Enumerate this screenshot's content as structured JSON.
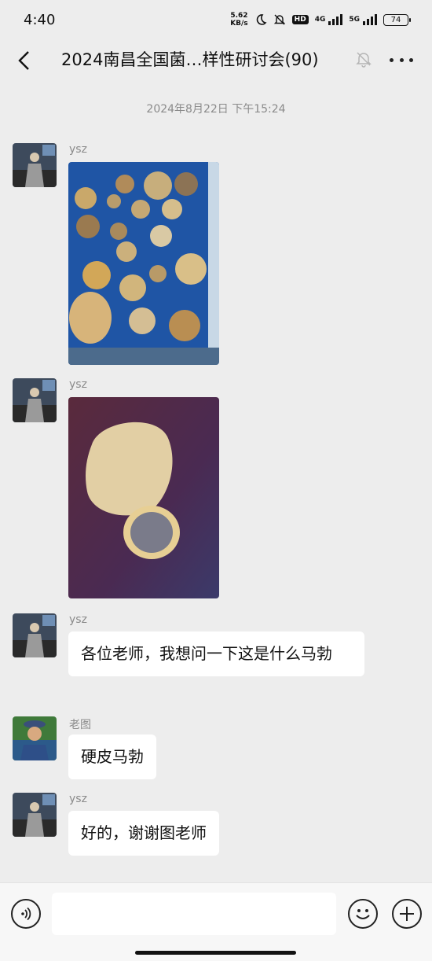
{
  "status_bar": {
    "time": "4:40",
    "speed_value": "5.62",
    "speed_unit": "KB/s",
    "hd_badge": "HD",
    "network_1": "4G",
    "network_2": "5G",
    "battery": "74"
  },
  "header": {
    "title": "2024南昌全国菌…样性研讨会(90)",
    "back_icon": "chevron-left-icon",
    "mute_icon": "bell-off-icon",
    "more_icon": "more-dots-icon"
  },
  "chat": {
    "timestamp": "2024年8月22日 下午15:24",
    "messages": [
      {
        "sender": "ysz",
        "type": "image",
        "image_desc": "puffballs on blue cloth"
      },
      {
        "sender": "ysz",
        "type": "image",
        "image_desc": "puffball and cross-section on purple surface"
      },
      {
        "sender": "ysz",
        "type": "text",
        "text": "各位老师，我想问一下这是什么马勃"
      },
      {
        "sender": "老图",
        "type": "text",
        "text": "硬皮马勃"
      },
      {
        "sender": "ysz",
        "type": "text",
        "text": "好的，谢谢图老师"
      }
    ]
  },
  "input_bar": {
    "voice_icon": "voice-icon",
    "emoji_icon": "emoji-icon",
    "plus_icon": "plus-icon",
    "input_value": ""
  },
  "colors": {
    "background": "#ededed",
    "bubble": "#ffffff",
    "meta_text": "#8a8a8a"
  }
}
